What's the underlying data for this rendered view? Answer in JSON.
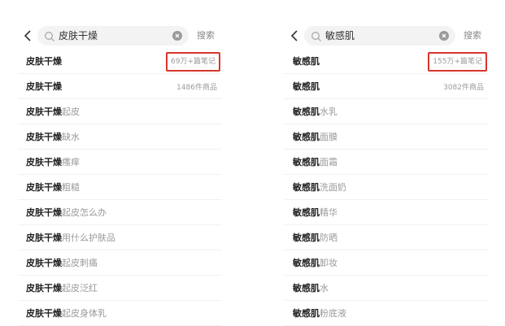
{
  "left": {
    "search": {
      "query": "皮肤干燥",
      "button": "搜索"
    },
    "items": [
      {
        "base": "皮肤干燥",
        "suffix": "",
        "meta": "69万+篇笔记"
      },
      {
        "base": "皮肤干燥",
        "suffix": "",
        "meta": "1486件商品"
      },
      {
        "base": "皮肤干燥",
        "suffix": "起皮",
        "meta": ""
      },
      {
        "base": "皮肤干燥",
        "suffix": "缺水",
        "meta": ""
      },
      {
        "base": "皮肤干燥",
        "suffix": "瘙痒",
        "meta": ""
      },
      {
        "base": "皮肤干燥",
        "suffix": "粗糙",
        "meta": ""
      },
      {
        "base": "皮肤干燥",
        "suffix": "起皮怎么办",
        "meta": ""
      },
      {
        "base": "皮肤干燥",
        "suffix": "用什么护肤品",
        "meta": ""
      },
      {
        "base": "皮肤干燥",
        "suffix": "起皮刺痛",
        "meta": ""
      },
      {
        "base": "皮肤干燥",
        "suffix": "起皮泛红",
        "meta": ""
      },
      {
        "base": "皮肤干燥",
        "suffix": "起皮身体乳",
        "meta": ""
      }
    ]
  },
  "right": {
    "search": {
      "query": "敏感肌",
      "button": "搜索"
    },
    "items": [
      {
        "base": "敏感肌",
        "suffix": "",
        "meta": "155万+篇笔记"
      },
      {
        "base": "敏感肌",
        "suffix": "",
        "meta": "3082件商品"
      },
      {
        "base": "敏感肌",
        "suffix": "水乳",
        "meta": ""
      },
      {
        "base": "敏感肌",
        "suffix": "面膜",
        "meta": ""
      },
      {
        "base": "敏感肌",
        "suffix": "面霜",
        "meta": ""
      },
      {
        "base": "敏感肌",
        "suffix": "洗面奶",
        "meta": ""
      },
      {
        "base": "敏感肌",
        "suffix": "精华",
        "meta": ""
      },
      {
        "base": "敏感肌",
        "suffix": "防晒",
        "meta": ""
      },
      {
        "base": "敏感肌",
        "suffix": "卸妆",
        "meta": ""
      },
      {
        "base": "敏感肌",
        "suffix": "水",
        "meta": ""
      },
      {
        "base": "敏感肌",
        "suffix": "粉底液",
        "meta": ""
      }
    ]
  },
  "highlight_color": "#d6362c"
}
